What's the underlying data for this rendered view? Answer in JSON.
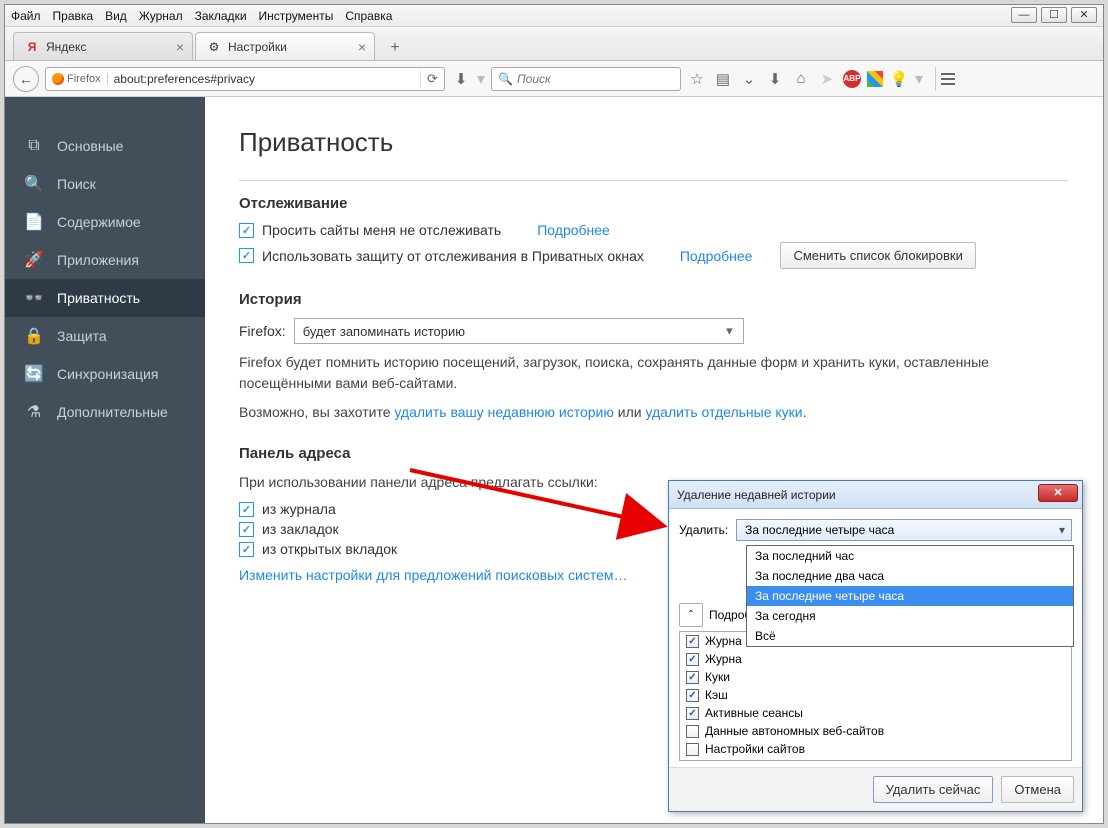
{
  "menubar": [
    "Файл",
    "Правка",
    "Вид",
    "Журнал",
    "Закладки",
    "Инструменты",
    "Справка"
  ],
  "tabs": [
    {
      "label": "Яндекс",
      "active": false
    },
    {
      "label": "Настройки",
      "active": true
    }
  ],
  "url": {
    "identity": "Firefox",
    "value": "about:preferences#privacy"
  },
  "search_placeholder": "Поиск",
  "sidebar": [
    {
      "icon": "⧉",
      "label": "Основные"
    },
    {
      "icon": "🔍",
      "label": "Поиск"
    },
    {
      "icon": "📄",
      "label": "Содержимое"
    },
    {
      "icon": "🚀",
      "label": "Приложения"
    },
    {
      "icon": "👓",
      "label": "Приватность",
      "selected": true
    },
    {
      "icon": "🔒",
      "label": "Защита"
    },
    {
      "icon": "🔄",
      "label": "Синхронизация"
    },
    {
      "icon": "⚗",
      "label": "Дополнительные"
    }
  ],
  "page": {
    "title": "Приватность",
    "tracking_header": "Отслеживание",
    "track1": "Просить сайты меня не отслеживать",
    "track2": "Использовать защиту от отслеживания в Приватных окнах",
    "more": "Подробнее",
    "change_blocklist": "Сменить список блокировки",
    "history_header": "История",
    "firefox_label": "Firefox:",
    "history_mode": "будет запоминать историю",
    "history_desc": "Firefox будет помнить историю посещений, загрузок, поиска, сохранять данные форм и хранить куки, оставленные посещёнными вами веб-сайтами.",
    "maybe": "Возможно, вы захотите ",
    "clear_recent": "удалить вашу недавнюю историю",
    "or": " или ",
    "clear_cookies": "удалить отдельные куки",
    "dot": ".",
    "addr_header": "Панель адреса",
    "addr_sub": "При использовании панели адреса предлагать ссылки:",
    "from_history": "из журнала",
    "from_bookmarks": "из закладок",
    "from_open": "из открытых вкладок",
    "change_search": "Изменить настройки для предложений поисковых систем…",
    "details": "Подробности"
  },
  "dialog": {
    "title": "Удаление недавней истории",
    "label": "Удалить:",
    "selected": "За последние четыре часа",
    "options": [
      "За последний час",
      "За последние два часа",
      "За последние четыре часа",
      "За сегодня",
      "Всё"
    ],
    "items": [
      {
        "label": "Журна",
        "checked": true
      },
      {
        "label": "Журна",
        "checked": true
      },
      {
        "label": "Куки",
        "checked": true
      },
      {
        "label": "Кэш",
        "checked": true
      },
      {
        "label": "Активные сеансы",
        "checked": true
      },
      {
        "label": "Данные автономных веб-сайтов",
        "checked": false
      },
      {
        "label": "Настройки сайтов",
        "checked": false
      }
    ],
    "ok": "Удалить сейчас",
    "cancel": "Отмена"
  }
}
